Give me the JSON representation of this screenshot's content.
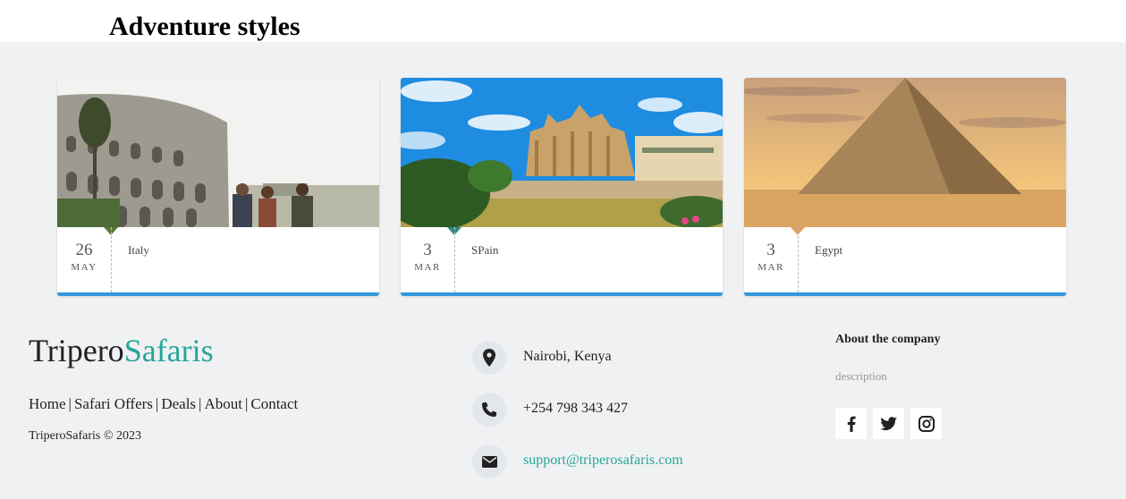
{
  "page_title": "Adventure styles",
  "cards": [
    {
      "day": "26",
      "month": "MAY",
      "location": "Italy",
      "image": "colosseum-photo"
    },
    {
      "day": "3",
      "month": "MAR",
      "location": "SPain",
      "image": "palma-cathedral-photo"
    },
    {
      "day": "3",
      "month": "MAR",
      "location": "Egypt",
      "image": "pyramid-photo"
    }
  ],
  "footer": {
    "brand_part1": "Tripero",
    "brand_part2": "Safaris",
    "links": [
      "Home",
      "Safari Offers",
      "Deals",
      "About",
      "Contact"
    ],
    "separator": "|",
    "copyright": "TriperoSafaris © 2023",
    "contact": {
      "address": "Nairobi, Kenya",
      "phone": "+254 798 343 427",
      "email": "support@triperosafaris.com"
    },
    "about_title": "About the company",
    "about_description": "description",
    "social": [
      "facebook-icon",
      "twitter-icon",
      "instagram-icon"
    ]
  },
  "colors": {
    "accent": "#26a69a",
    "card_border": "#3498db",
    "background": "#f0f1f3"
  }
}
